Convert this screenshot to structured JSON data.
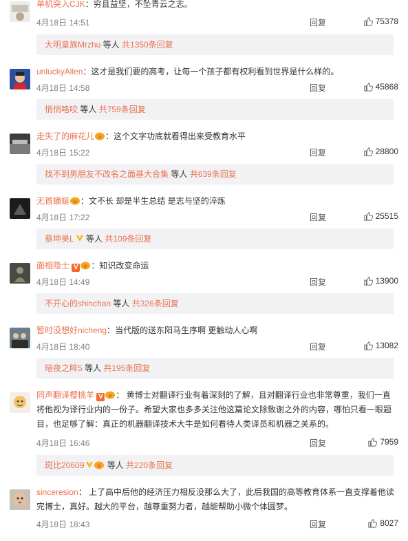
{
  "comments": [
    {
      "author": "单机突入CJK",
      "content": "穷且益坚，不坠青云之志。",
      "time": "4月18日 14:51",
      "reply_label": "回复",
      "likes": "75378",
      "subreply": {
        "name": "大明皇族Mrzhu",
        "suffix": " 等人 ",
        "count": "共1350条回复"
      }
    },
    {
      "author": "unluckyAllen",
      "content": "这才是我们要的高考，让每一个孩子都有权利看到世界是什么样的。",
      "time": "4月18日 14:58",
      "reply_label": "回复",
      "likes": "45868",
      "subreply": {
        "name": "悄悄咯咬",
        "suffix": " 等人 ",
        "count": "共759条回复"
      }
    },
    {
      "author": "走失了的麻花儿",
      "content": "这个文字功底就看得出来受教育水平",
      "time": "4月18日 15:22",
      "reply_label": "回复",
      "likes": "28800",
      "subreply": {
        "name": "找不到男朋友不改名之面基大合集",
        "suffix": " 等人 ",
        "count": "共639条回复"
      }
    },
    {
      "author": "无首蟠蜒",
      "content": "文不长 却是半生总结 是志与坚的淬炼",
      "time": "4月18日 17:22",
      "reply_label": "回复",
      "likes": "25515",
      "subreply": {
        "name": "蔡坤昊L",
        "suffix": " 等人 ",
        "count": "共109条回复"
      }
    },
    {
      "author": "面相隐士",
      "content": "知识改变命运",
      "time": "4月18日 14:49",
      "reply_label": "回复",
      "likes": "13900",
      "subreply": {
        "name": "不开心的shinchan",
        "suffix": " 等人 ",
        "count": "共326条回复"
      }
    },
    {
      "author": "暂时没想好nicheng",
      "content": "当代版的送东阳马生序啊 更触动人心啊",
      "time": "4月18日 18:40",
      "reply_label": "回复",
      "likes": "13082",
      "subreply": {
        "name": "暗夜之眸5",
        "suffix": " 等人 ",
        "count": "共195条回复"
      }
    },
    {
      "author": "同声翻译樱桃羊",
      "content": "黄博士对翻译行业有着深刻的了解，且对翻译行业也非常尊重，我们一直将他视为译行业内的一份子。希望大家也多多关注他这篇论文除致谢之外的内容，哪怕只看一眼题目，也足够了解：真正的机器翻译技术大牛是如何看待人类译员和机器之关系的。",
      "time": "4月18日 16:46",
      "reply_label": "回复",
      "likes": "7959",
      "subreply": {
        "name": "斑比20609",
        "suffix": " 等人 ",
        "count": "共220条回复"
      }
    },
    {
      "author": "sinceresion",
      "content": "上了高中后他的经济压力相反没那么大了，此后我国的高等教育体系一直支撑着他读完博士，真好。越大的平台，越尊重努力者，越能帮助小微个体圆梦。",
      "time": "4月18日 18:43",
      "reply_label": "回复",
      "likes": "8027"
    }
  ]
}
